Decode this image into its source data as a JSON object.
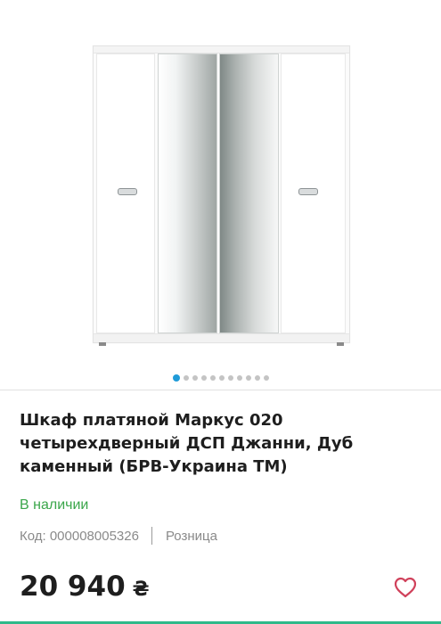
{
  "product": {
    "title": "Шкаф платяной Маркус 020 четырехдверный ДСП Джанни, Дуб каменный (БРВ-Украина ТМ)",
    "stock_status": "В наличии",
    "code_label": "Код: 000008005326",
    "price_type": "Розница",
    "price": "20 940",
    "currency": "₴"
  },
  "gallery": {
    "image_count": 11,
    "active_index": 0,
    "image_subject": "wardrobe"
  },
  "colors": {
    "in_stock": "#3aa64a",
    "active_dot": "#1f9bd8",
    "favorite_icon": "#d0415b",
    "accent_bar": "#2fb98a"
  },
  "icons": {
    "favorite": "heart-icon"
  }
}
